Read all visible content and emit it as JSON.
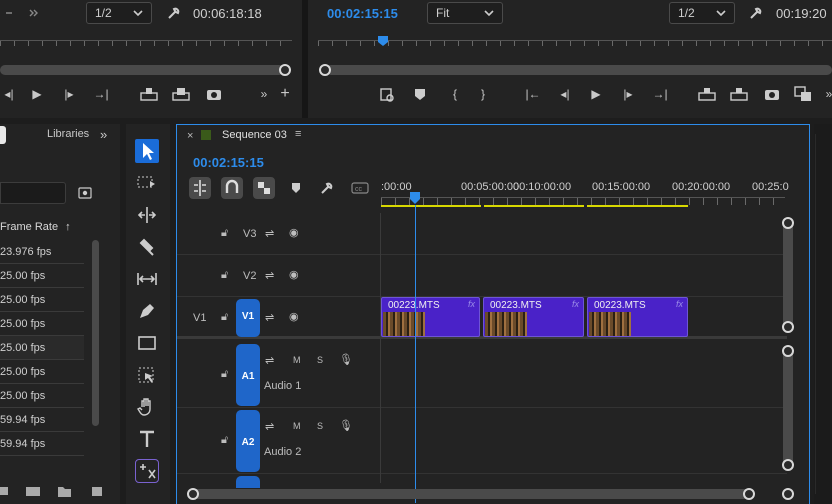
{
  "source_monitor": {
    "resolution": "1/2",
    "timecode": "00:06:18:18"
  },
  "program_monitor": {
    "timecode": "00:02:15:15",
    "zoom": "Fit",
    "resolution": "1/2",
    "timecode_right": "00:19:20"
  },
  "project_panel": {
    "tab_libraries": "Libraries",
    "column_header": "Frame Rate",
    "rows": [
      "23.976 fps",
      "25.00 fps",
      "25.00 fps",
      "25.00 fps",
      "25.00 fps",
      "25.00 fps",
      "25.00 fps",
      "59.94 fps",
      "59.94 fps"
    ]
  },
  "timeline": {
    "sequence_name": "Sequence 03",
    "playhead_timecode": "00:02:15:15",
    "ruler_labels": [
      ":00:00",
      "00:05:00:00",
      "00:10:00:00",
      "00:15:00:00",
      "00:20:00:00",
      "00:25:0"
    ],
    "tracks": {
      "v3": "V3",
      "v2": "V2",
      "v1_left": "V1",
      "v1": "V1",
      "a1": "A1",
      "a1_name": "Audio 1",
      "a2": "A2",
      "a2_name": "Audio 2",
      "mute": "M",
      "solo": "S"
    },
    "clips": [
      {
        "name": "00223.MTS",
        "fx": "fx"
      },
      {
        "name": "00223.MTS",
        "fx": "fx"
      },
      {
        "name": "00223.MTS",
        "fx": "fx"
      }
    ]
  },
  "colors": {
    "accent": "#2d8ceb",
    "clip": "#4a22c8",
    "track_target": "#1f66c9"
  }
}
